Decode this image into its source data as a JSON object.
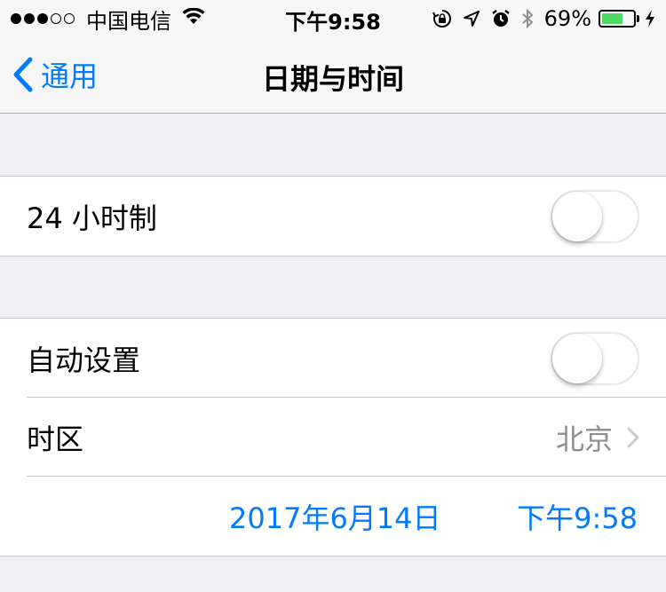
{
  "status_bar": {
    "signal_dots_filled": 3,
    "signal_dots_total": 5,
    "carrier": "中国电信",
    "time": "下午9:58",
    "battery_percent": "69%",
    "battery_level": 0.69,
    "icons": [
      "wifi-icon",
      "orientation-lock-icon",
      "location-arrow-icon",
      "alarm-icon",
      "bluetooth-icon",
      "charging-bolt-icon"
    ]
  },
  "nav": {
    "back_label": "通用",
    "title": "日期与时间"
  },
  "settings": {
    "hour24": {
      "label": "24 小时制",
      "enabled": false
    },
    "auto_set": {
      "label": "自动设置",
      "enabled": false
    },
    "time_zone": {
      "label": "时区",
      "value": "北京"
    },
    "date": "2017年6月14日",
    "time": "下午9:58"
  },
  "colors": {
    "accent": "#007aff",
    "background": "#efeff4",
    "battery_green": "#4cd964",
    "secondary_text": "#8e8e93"
  }
}
